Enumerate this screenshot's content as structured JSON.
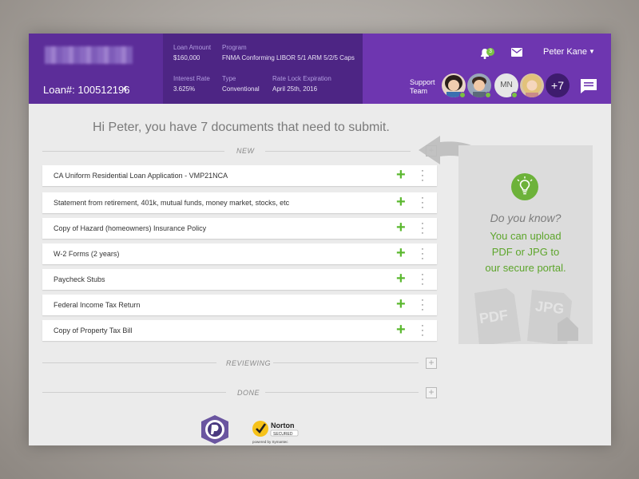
{
  "header": {
    "loan_number": "Loan#: 100512196",
    "loan_amount_label": "Loan Amount",
    "loan_amount": "$160,000",
    "program_label": "Program",
    "program": "FNMA Conforming LIBOR 5/1 ARM 5/2/5 Caps",
    "interest_rate_label": "Interest Rate",
    "interest_rate": "3.625%",
    "type_label": "Type",
    "type": "Conventional",
    "rate_lock_label": "Rate Lock Expiration",
    "rate_lock": "April 25th, 2016",
    "notification_count": "3",
    "user_name": "Peter Kane",
    "support_label": "Support Team",
    "avatar_initials": "MN",
    "more_count": "+7"
  },
  "greeting": "Hi Peter, you have 7 documents that need to submit.",
  "sections": {
    "new": "NEW",
    "reviewing": "REVIEWING",
    "done": "DONE"
  },
  "documents": [
    "CA Uniform Residential Loan Application - VMP21NCA",
    "Statement from retirement, 401k, mutual funds, money market, stocks, etc",
    "Copy of Hazard (homeowners) Insurance Policy",
    "W-2 Forms (2 years)",
    "Paycheck Stubs",
    "Federal Income Tax Return",
    "Copy of Property Tax Bill"
  ],
  "tip": {
    "heading": "Do you know?",
    "line1": "You can upload",
    "line2": "PDF or JPG to",
    "line3": "our secure portal.",
    "pdf": "PDF",
    "jpg": "JPG"
  },
  "badges": {
    "norton_name": "Norton",
    "norton_secured": "SECURED",
    "norton_powered": "powered by Symantec"
  },
  "colors": {
    "header_purple": "#6e36b0",
    "brand_purple": "#5c2d99",
    "info_purple": "#4d2584",
    "accent_green": "#6db23a"
  }
}
